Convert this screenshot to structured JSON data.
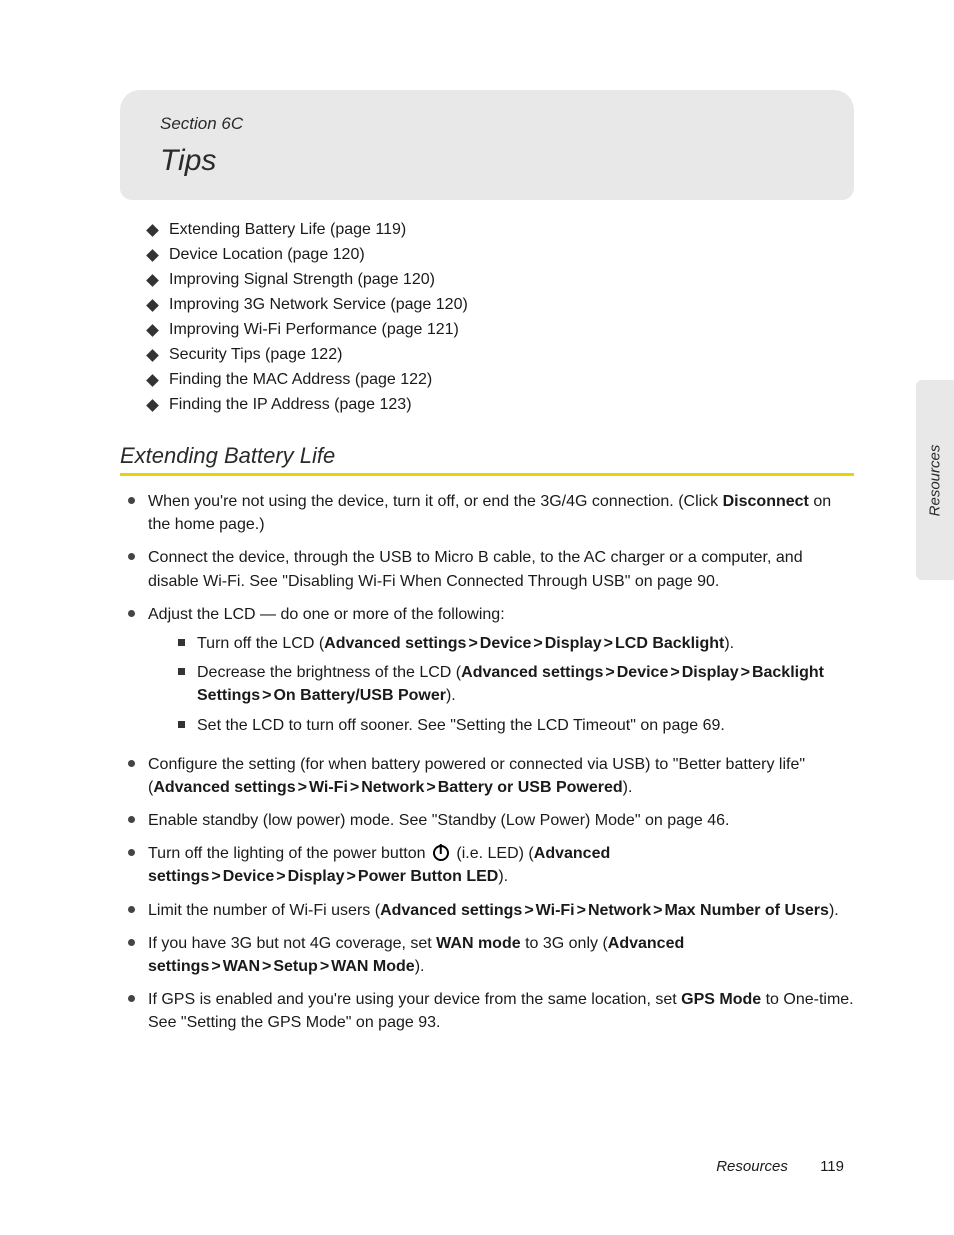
{
  "header": {
    "section_label": "Section 6C",
    "title": "Tips"
  },
  "toc": [
    "Extending Battery Life (page 119)",
    "Device Location (page 120)",
    "Improving Signal Strength (page 120)",
    "Improving 3G Network Service (page 120)",
    "Improving Wi-Fi Performance (page 121)",
    "Security Tips (page 122)",
    "Finding the MAC Address (page 122)",
    "Finding the IP Address (page 123)"
  ],
  "subheading": "Extending Battery Life",
  "bullets": {
    "b0_pre": "When you're not using the device, turn it off, or end the 3G/4G connection. (Click ",
    "b0_bold": "Disconnect",
    "b0_post": " on the home page.)",
    "b1": "Connect the device, through the USB to Micro B cable, to the AC charger or a computer, and disable Wi-Fi. See \"Disabling Wi-Fi When Connected Through USB\" on page 90.",
    "b2": "Adjust the LCD — do one or more of the following:",
    "b2_sub": {
      "s0_pre": "Turn off the LCD (",
      "s0_path": [
        "Advanced settings",
        "Device",
        "Display",
        "LCD Backlight"
      ],
      "s0_post": ").",
      "s1_pre": "Decrease the brightness of the LCD (",
      "s1_path": [
        "Advanced settings",
        "Device",
        "Display",
        "Backlight Settings",
        "On Battery/USB Power"
      ],
      "s1_post": ").",
      "s2": "Set the LCD to turn off sooner. See \"Setting the LCD Timeout\" on page 69."
    },
    "b3_pre": "Configure the setting (for when battery powered or connected via USB) to \"Better battery life\" (",
    "b3_path": [
      "Advanced settings",
      "Wi-Fi",
      "Network",
      "Battery or USB Powered"
    ],
    "b3_post": ").",
    "b4": "Enable standby (low power) mode. See \"Standby (Low Power) Mode\" on page 46.",
    "b5_pre": "Turn off the lighting of the power button ",
    "b5_mid": " (i.e. LED) (",
    "b5_path": [
      "Advanced settings",
      "Device",
      "Display",
      "Power Button LED"
    ],
    "b5_post": ").",
    "b6_pre": "Limit the number of Wi-Fi users (",
    "b6_path": [
      "Advanced settings",
      "Wi-Fi",
      "Network",
      "Max Number of Users"
    ],
    "b6_post": ").",
    "b7_pre": "If you have 3G but not 4G coverage, set ",
    "b7_b1": "WAN mode",
    "b7_mid": " to 3G only (",
    "b7_path": [
      "Advanced settings",
      "WAN",
      "Setup",
      "WAN Mode"
    ],
    "b7_post": ").",
    "b8_pre": "If GPS is enabled and you're using your device from the same location, set ",
    "b8_b1": "GPS Mode",
    "b8_post": " to One-time. See \"Setting the GPS Mode\" on page 93."
  },
  "side_tab": "Resources",
  "footer": {
    "label": "Resources",
    "page": "119"
  },
  "gt": ">"
}
